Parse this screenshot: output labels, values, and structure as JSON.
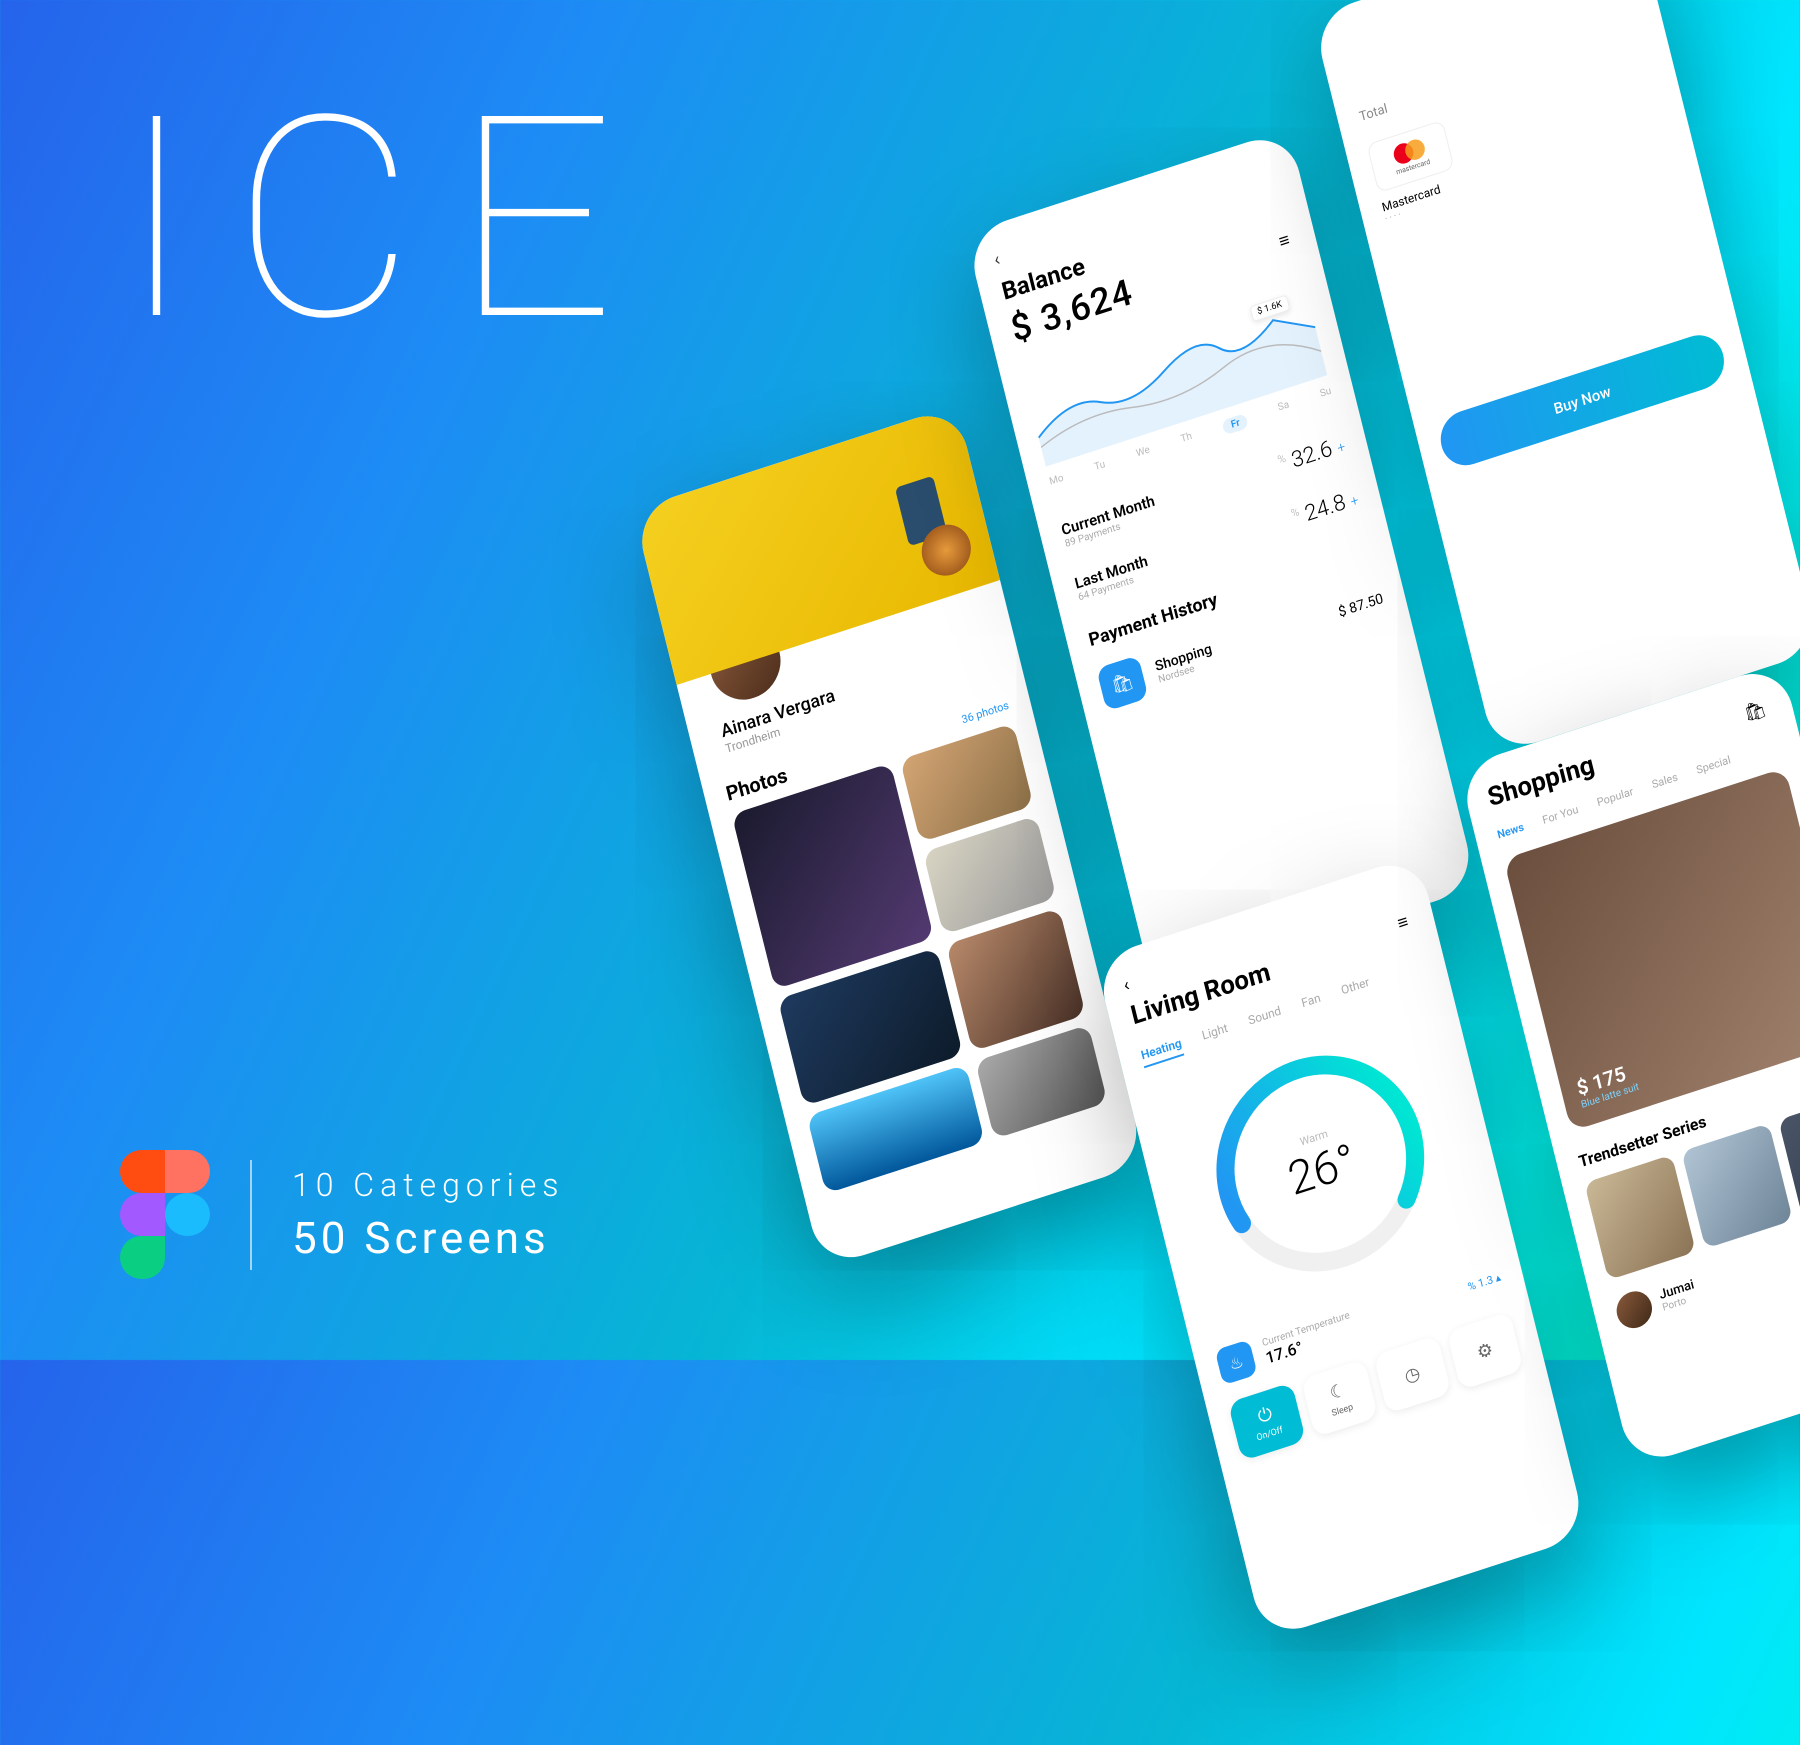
{
  "hero": {
    "title": "ICE"
  },
  "footer": {
    "line1": "10 Categories",
    "line2": "50 Screens"
  },
  "photos_screen": {
    "user_name": "Ainara Vergara",
    "user_location": "Trondheim",
    "section": "Photos",
    "count": "36 photos"
  },
  "balance_screen": {
    "back": "‹",
    "title": "Balance",
    "amount": "$ 3,624",
    "tooltip": "$ 1.6K",
    "days": [
      "Mo",
      "Tu",
      "We",
      "Th",
      "Fr",
      "Sa",
      "Su"
    ],
    "active_day": "Fr",
    "current_label": "Current Month",
    "current_sub": "89 Payments",
    "current_value": "32.6",
    "last_label": "Last Month",
    "last_sub": "64 Payments",
    "last_value": "24.8",
    "history_title": "Payment History",
    "item1_title": "Shopping",
    "item1_sub": "Nordsee",
    "item1_amount": "$ 87.50"
  },
  "living_screen": {
    "back": "‹",
    "title": "Living Room",
    "tabs": [
      "Heating",
      "Light",
      "Sound",
      "Fan",
      "Other"
    ],
    "dial_label": "Warm",
    "dial_temp": "26°",
    "cur_label": "Current Temperature",
    "cur_value": "17.6°",
    "cur_pct": "% 1.3 ▴",
    "btn1": "On/Off",
    "btn2": "Sleep"
  },
  "card_screen": {
    "total_label": "Total",
    "card_brand": "mastercard",
    "card_name": "Mastercard",
    "card_num": "····",
    "buy_label": "Buy Now"
  },
  "shopping_screen": {
    "title": "Shopping",
    "tabs": [
      "News",
      "For You",
      "Popular",
      "Sales",
      "Special"
    ],
    "hero_price": "$ 175",
    "hero_sub": "Blue latte suit",
    "section": "Trendsetter Series",
    "user_name": "Jumai",
    "user_loc": "Porto"
  }
}
